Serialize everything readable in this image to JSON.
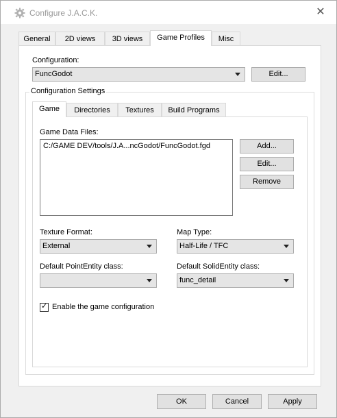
{
  "window": {
    "title": "Configure J.A.C.K.",
    "close_glyph": "✕"
  },
  "main_tabs": [
    {
      "label": "General"
    },
    {
      "label": "2D views"
    },
    {
      "label": "3D views"
    },
    {
      "label": "Game Profiles"
    },
    {
      "label": "Misc"
    }
  ],
  "configuration": {
    "label": "Configuration:",
    "selected": "FuncGodot",
    "edit_button": "Edit..."
  },
  "settings": {
    "group_title": "Configuration Settings",
    "tabs": [
      {
        "label": "Game"
      },
      {
        "label": "Directories"
      },
      {
        "label": "Textures"
      },
      {
        "label": "Build Programs"
      }
    ],
    "game_data_files_label": "Game Data Files:",
    "game_data_files": [
      "C:/GAME DEV/tools/J.A...ncGodot/FuncGodot.fgd"
    ],
    "add_button": "Add...",
    "edit_button": "Edit...",
    "remove_button": "Remove",
    "texture_format_label": "Texture Format:",
    "texture_format_value": "External",
    "map_type_label": "Map Type:",
    "map_type_value": "Half-Life / TFC",
    "point_entity_label": "Default PointEntity class:",
    "point_entity_value": "",
    "solid_entity_label": "Default SolidEntity class:",
    "solid_entity_value": "func_detail",
    "enable_label": "Enable the game configuration",
    "enable_checked": true
  },
  "footer": {
    "ok": "OK",
    "cancel": "Cancel",
    "apply": "Apply"
  }
}
